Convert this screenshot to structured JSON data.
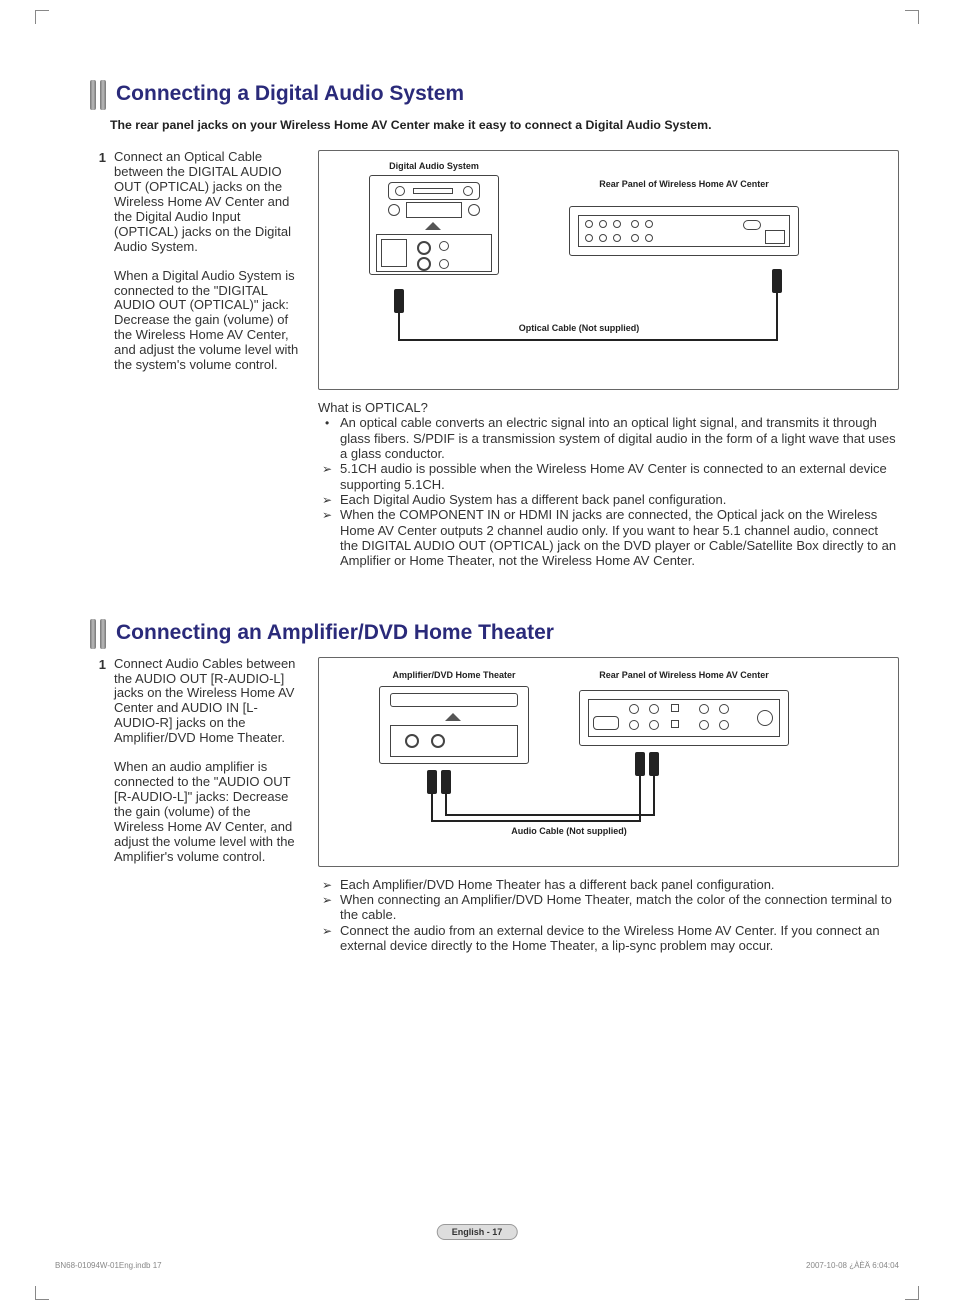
{
  "section1": {
    "title": "Connecting a Digital Audio System",
    "subtitle": "The rear panel jacks on your Wireless Home AV Center make it easy to connect a Digital Audio System.",
    "step_num": "1",
    "step_p1": "Connect an Optical Cable between the DIGITAL AUDIO OUT (OPTICAL) jacks on the Wireless Home AV Center and the Digital Audio Input (OPTICAL) jacks on the Digital Audio System.",
    "step_p2": "When a Digital Audio System is connected to the \"DIGITAL AUDIO OUT (OPTICAL)\" jack:",
    "step_p3": "Decrease the gain (volume) of the Wireless Home AV Center, and adjust the volume level with the system's volume control.",
    "diag": {
      "label_left": "Digital Audio System",
      "label_right": "Rear Panel of Wireless Home AV Center",
      "cable": "Optical Cable (Not supplied)"
    },
    "optical_q": "What is OPTICAL?",
    "bul1": "An optical cable converts an electric signal into an optical light signal, and transmits it through glass fibers. S/PDIF is a transmission system of digital audio in the form of a light wave that uses a glass conductor.",
    "bul2": "5.1CH audio is possible when the Wireless Home AV Center is connected to an external device supporting 5.1CH.",
    "bul3": "Each Digital Audio System has a different back panel configuration.",
    "bul4": "When the COMPONENT IN or HDMI IN jacks are connected, the Optical jack on the Wireless Home AV Center outputs 2 channel audio only. If you want to hear 5.1 channel audio, connect the DIGITAL AUDIO OUT (OPTICAL) jack on the DVD player or Cable/Satellite Box directly to an Amplifier or Home Theater, not the Wireless Home AV Center."
  },
  "section2": {
    "title": "Connecting an Amplifier/DVD Home Theater",
    "step_num": "1",
    "step_p1": "Connect Audio Cables between the AUDIO OUT [R-AUDIO-L] jacks on the Wireless Home AV Center and AUDIO IN [L-AUDIO-R] jacks on the Amplifier/DVD Home Theater.",
    "step_p2": "When an audio amplifier is connected to the \"AUDIO OUT [R-AUDIO-L]\" jacks: Decrease the gain (volume) of the Wireless Home AV Center, and adjust the volume level with the Amplifier's volume control.",
    "diag": {
      "label_left": "Amplifier/DVD Home Theater",
      "label_right": "Rear Panel of Wireless Home AV Center",
      "cable": "Audio Cable (Not supplied)"
    },
    "bul1": "Each Amplifier/DVD Home Theater has a different back panel configuration.",
    "bul2": "When connecting an Amplifier/DVD Home Theater, match the color of the connection terminal to the cable.",
    "bul3": "Connect the audio from an external device to the Wireless Home AV Center. If you connect an external device directly to the Home Theater, a lip-sync problem may occur."
  },
  "footer": {
    "page": "English - 17",
    "left": "BN68-01094W-01Eng.indb   17",
    "right": "2007-10-08   ¿ÀÈÄ 6:04:04"
  }
}
